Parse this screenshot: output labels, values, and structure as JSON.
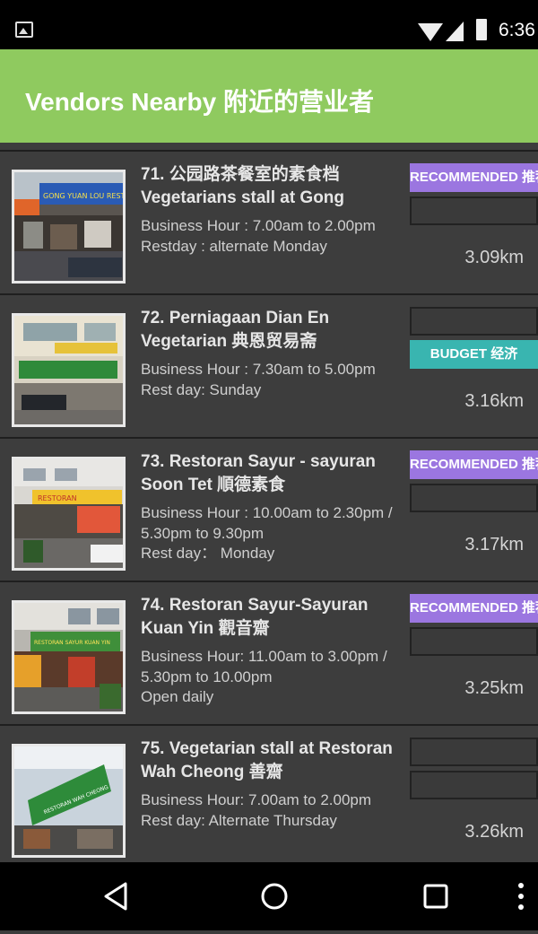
{
  "status_bar": {
    "time": "6:36"
  },
  "app_bar": {
    "title": "Vendors Nearby 附近的营业者"
  },
  "vendors": [
    {
      "name": "71. 公园路茶餐室的素食档 Vegetarians stall at Gong",
      "description": "Business Hour : 7.00am to 2.00pm Restday : alternate Monday",
      "tags": [
        "RECOMMENDED 推荐",
        ""
      ],
      "distance": "3.09km"
    },
    {
      "name": "72. Perniagaan Dian En Vegetarian 典恩贸易斋",
      "description": "Business Hour : 7.30am to 5.00pm\nRest day: Sunday",
      "tags": [
        "",
        "BUDGET 经济"
      ],
      "distance": "3.16km"
    },
    {
      "name": "73. Restoran Sayur - sayuran Soon Tet  順德素食",
      "description": "Business Hour : 10.00am to 2.30pm / 5.30pm to 9.30pm\nRest day： Monday",
      "tags": [
        "RECOMMENDED 推荐",
        ""
      ],
      "distance": "3.17km"
    },
    {
      "name": "74. Restoran Sayur-Sayuran Kuan Yin 觀音齋",
      "description": "Business Hour: 11.00am to 3.00pm / 5.30pm to 10.00pm\nOpen daily",
      "tags": [
        "RECOMMENDED 推荐",
        ""
      ],
      "distance": "3.25km"
    },
    {
      "name": "75. Vegetarian stall at Restoran Wah Cheong  善齋",
      "description": "Business Hour: 7.00am to 2.00pm Rest day: Alternate Thursday",
      "tags": [
        "",
        ""
      ],
      "distance": "3.26km"
    }
  ],
  "photo_signs": {
    "v71": "GONG YUAN LOU REST",
    "v72": "",
    "v73": "RESTORAN",
    "v74": "RESTORAN SAYUR KUAN YIN",
    "v75": "RESTORAN WAH CHEONG"
  },
  "colors": {
    "app_bar": "#8fca5f",
    "recommended": "#9b76e0",
    "budget": "#39b5b0",
    "list_bg": "#3d3d3d"
  }
}
